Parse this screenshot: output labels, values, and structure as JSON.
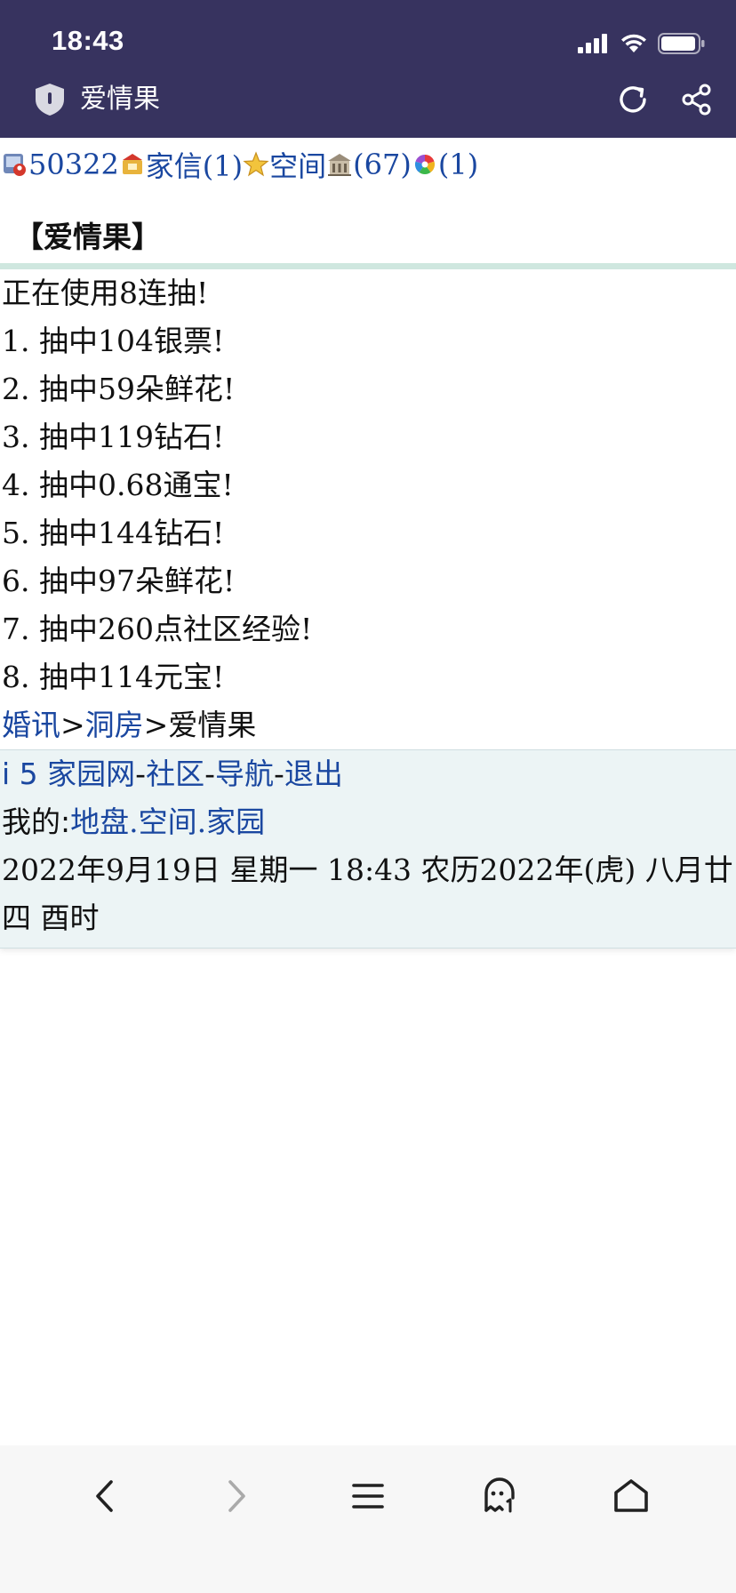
{
  "status_bar": {
    "time": "18:43"
  },
  "title_bar": {
    "title": "爱情果"
  },
  "info_row": {
    "id": "50322",
    "letters": "家信(1)",
    "space": "空间",
    "count": "(67)",
    "extra": "(1)"
  },
  "page": {
    "heading": "【爱情果】",
    "intro": "正在使用8连抽!",
    "results": [
      "1. 抽中104银票!",
      "2. 抽中59朵鲜花!",
      "3. 抽中119钻石!",
      "4. 抽中0.68通宝!",
      "5. 抽中144钻石!",
      "6. 抽中97朵鲜花!",
      "7. 抽中260点社区经验!",
      "8. 抽中114元宝!"
    ]
  },
  "breadcrumb": {
    "item1": "婚讯",
    "sep": ">",
    "item2": "洞房",
    "current": "爱情果"
  },
  "footer": {
    "site": "i 5 家园网",
    "dash": "-",
    "community": "社区",
    "nav": "导航",
    "logout": "退出",
    "mine_label": "我的:",
    "territory": "地盘",
    "dot": ".",
    "space": "空间",
    "home": "家园",
    "datetime": "2022年9月19日  星期一  18:43  农历2022年(虎)  八月廿四  酉时"
  },
  "colors": {
    "header_bg": "#37335f",
    "link": "#1a47a0",
    "footer_bg": "#ecf4f5",
    "divider": "#cfe7df"
  }
}
